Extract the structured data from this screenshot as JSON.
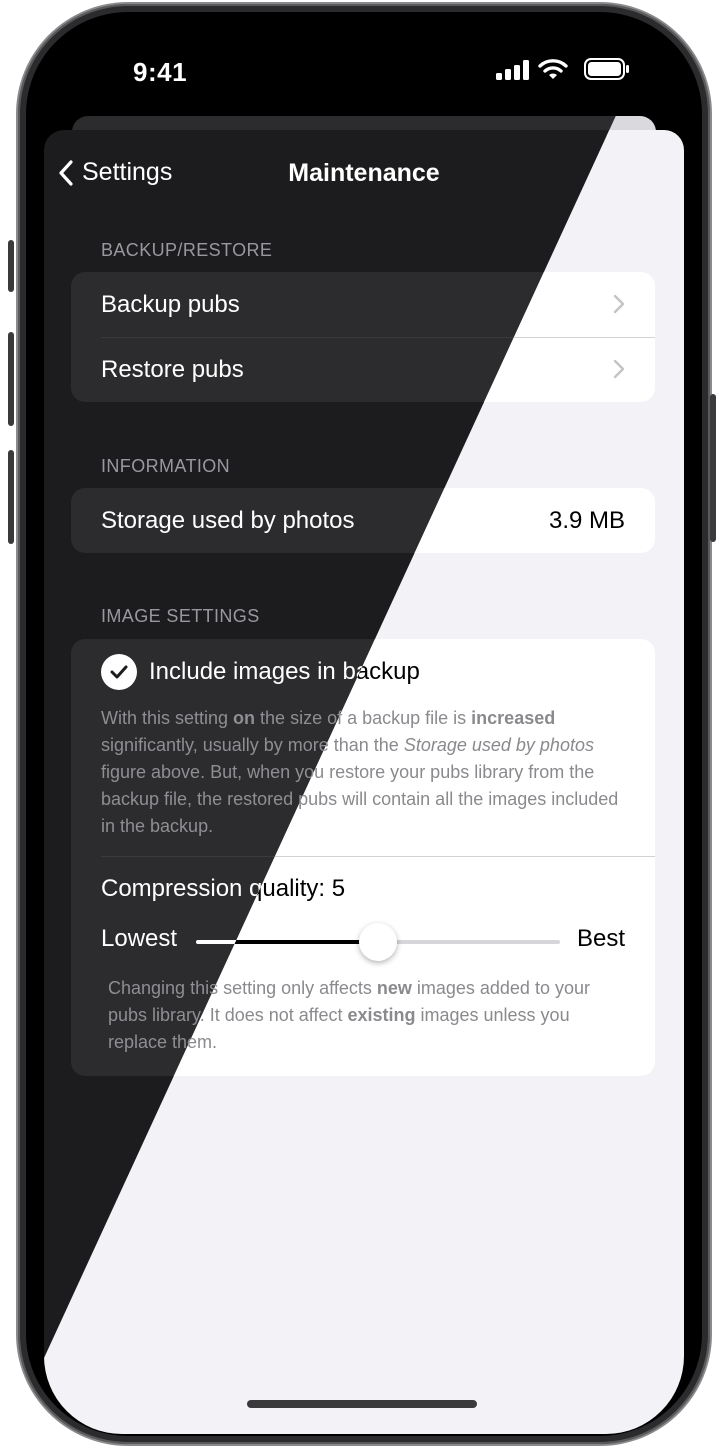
{
  "status": {
    "time": "9:41"
  },
  "nav": {
    "back_label": "Settings",
    "title": "Maintenance"
  },
  "sections": {
    "backup": {
      "header": "BACKUP/RESTORE",
      "items": [
        {
          "label": "Backup pubs"
        },
        {
          "label": "Restore pubs"
        }
      ]
    },
    "information": {
      "header": "INFORMATION",
      "storage_label": "Storage used by photos",
      "storage_value": "3.9 MB"
    },
    "image_settings": {
      "header": "IMAGE SETTINGS",
      "include_label": "Include images in backup",
      "include_checked": true,
      "description": {
        "t1": "With this setting ",
        "b1": "on",
        "t2": " the size of a backup file is ",
        "b2": "increased",
        "t3": " significantly, usually by more than the ",
        "i1": "Storage used by photos",
        "t4": " figure above. But, when you restore your pubs library from the backup file, the restored pubs will contain all the images included in the backup."
      },
      "compression_label": "Compression quality: 5",
      "compression_value": 5,
      "compression_min": 0,
      "compression_max": 10,
      "slider_low": "Lowest",
      "slider_high": "Best",
      "footnote": {
        "t1": "Changing this setting only affects ",
        "b1": "new",
        "t2": " images added to your pubs library. It does not affect ",
        "b2": "existing",
        "t3": " images unless you replace them."
      }
    }
  },
  "colors": {
    "dark_bg": "#1c1c1e",
    "dark_cell": "#2c2c2e",
    "light_bg": "#f2f2f7",
    "light_cell": "#ffffff"
  }
}
